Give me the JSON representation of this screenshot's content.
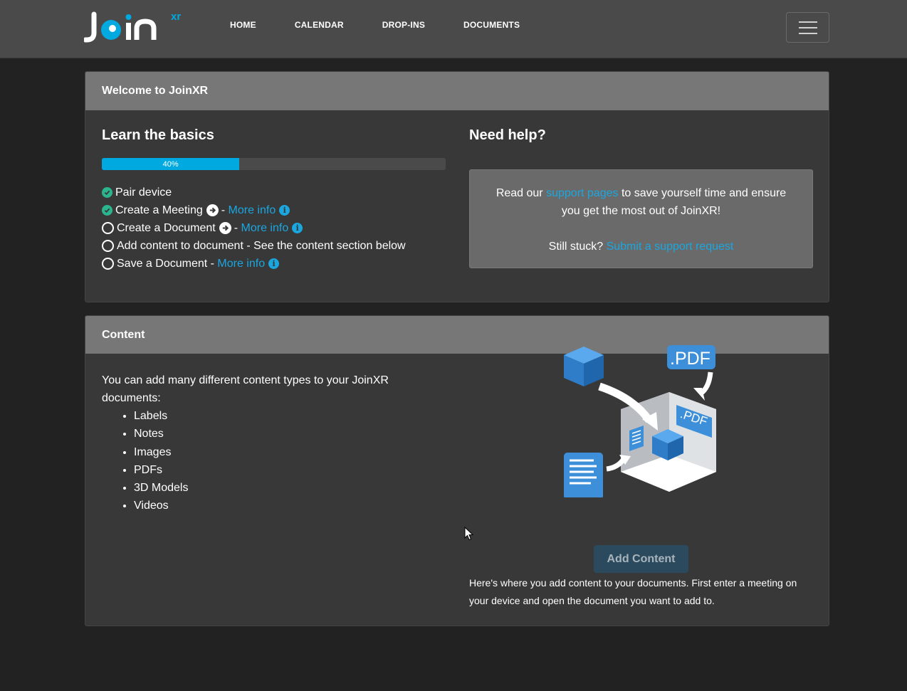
{
  "navbar": {
    "logo_text": "Join",
    "logo_superscript": "xr",
    "links": [
      "HOME",
      "CALENDAR",
      "DROP-INS",
      "DOCUMENTS"
    ],
    "menu_icon": "hamburger-icon"
  },
  "welcome": {
    "header": "Welcome to JoinXR",
    "basics_title": "Learn the basics",
    "progress_label": "40%",
    "progress_value": 0.4,
    "steps": [
      {
        "label": "Pair device",
        "done": true
      },
      {
        "label": "Create a Meeting",
        "done": true,
        "more_info": "More info"
      },
      {
        "label": "Create a Document",
        "done": false,
        "more_info": "More info"
      },
      {
        "label": "Add content to document - See the content section below",
        "done": false
      },
      {
        "label": "Save a Document -",
        "done": false,
        "more_info": "More info"
      }
    ],
    "separator": "-",
    "help_title": "Need help?",
    "help_read_prefix": "Read our",
    "help_link_support": "support pages",
    "help_read_suffix": "to save yourself time and ensure you get the most out of JoinXR!",
    "help_stuck_prefix": "Still stuck?",
    "help_link_request": "Submit a support request"
  },
  "content": {
    "header": "Content",
    "intro": "You can add many different content types to your JoinXR documents:",
    "types": [
      "Labels",
      "Notes",
      "Images",
      "PDFs",
      "3D Models",
      "Videos"
    ],
    "illustration_pdf_label": ".PDF",
    "add_button": "Add Content",
    "add_description": "Here's where you add content to your documents. First enter a meeting on your device and open the document you want to add to."
  },
  "colors": {
    "accent": "#1aa7e0",
    "check": "#2bb58e",
    "navbar": "#4a4a4a",
    "card": "#383838",
    "card_header": "#777777"
  }
}
